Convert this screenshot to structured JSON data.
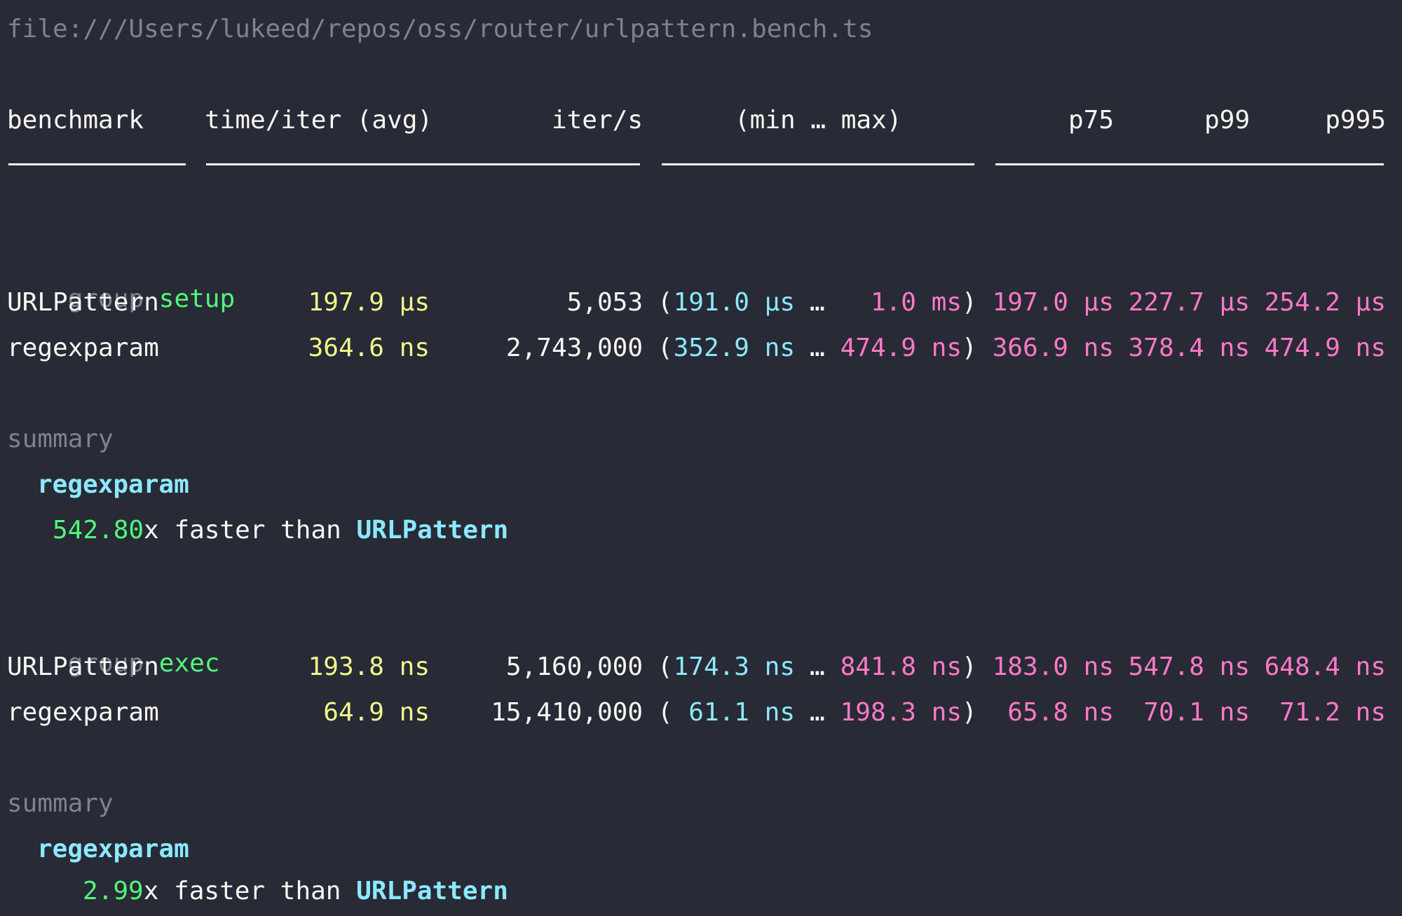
{
  "file_path": "file:///Users/lukeed/repos/oss/router/urlpattern.bench.ts",
  "header": {
    "benchmark": "benchmark",
    "time_iter": "time/iter (avg)",
    "iter_s": "iter/s",
    "min_max": "(min … max)",
    "p75": "p75",
    "p99": "p99",
    "p995": "p995"
  },
  "groups": [
    {
      "group_keyword": "group",
      "name": "setup",
      "rows": [
        {
          "name": "URLPattern",
          "avg": "197.9 µs",
          "iter_s": "5,053",
          "open": "(",
          "min": "191.0 µs",
          "ellipsis": "…",
          "max": "1.0 ms",
          "close": ")",
          "p75": "197.0 µs",
          "p99": "227.7 µs",
          "p995": "254.2 µs"
        },
        {
          "name": "regexparam",
          "avg": "364.6 ns",
          "iter_s": "2,743,000",
          "open": "(",
          "min": "352.9 ns",
          "ellipsis": "…",
          "max": "474.9 ns",
          "close": ")",
          "p75": "366.9 ns",
          "p99": "378.4 ns",
          "p995": "474.9 ns"
        }
      ],
      "summary": {
        "label": "summary",
        "winner": "regexparam",
        "factor": "542.80",
        "text": "x faster than ",
        "loser": "URLPattern"
      }
    },
    {
      "group_keyword": "group",
      "name": "exec",
      "rows": [
        {
          "name": "URLPattern",
          "avg": "193.8 ns",
          "iter_s": "5,160,000",
          "open": "(",
          "min": "174.3 ns",
          "ellipsis": "…",
          "max": "841.8 ns",
          "close": ")",
          "p75": "183.0 ns",
          "p99": "547.8 ns",
          "p995": "648.4 ns"
        },
        {
          "name": "regexparam",
          "avg": "64.9 ns",
          "iter_s": "15,410,000",
          "open": "(",
          "min": "61.1 ns",
          "ellipsis": "…",
          "max": "198.3 ns",
          "close": ")",
          "p75": "65.8 ns",
          "p99": "70.1 ns",
          "p995": "71.2 ns"
        }
      ],
      "summary": {
        "label": "summary",
        "winner": "regexparam",
        "factor": "2.99",
        "text": "x faster than ",
        "loser": "URLPattern"
      }
    }
  ],
  "colors": {
    "background": "#282a36",
    "foreground": "#f8f8f2",
    "dim": "#7f8192",
    "group_name": "#50fa7b",
    "avg": "#f1fa8c",
    "min": "#8be9fd",
    "max_percentiles": "#ff79c6",
    "summary_names": "#8be9fd",
    "summary_factor": "#50fa7b"
  }
}
